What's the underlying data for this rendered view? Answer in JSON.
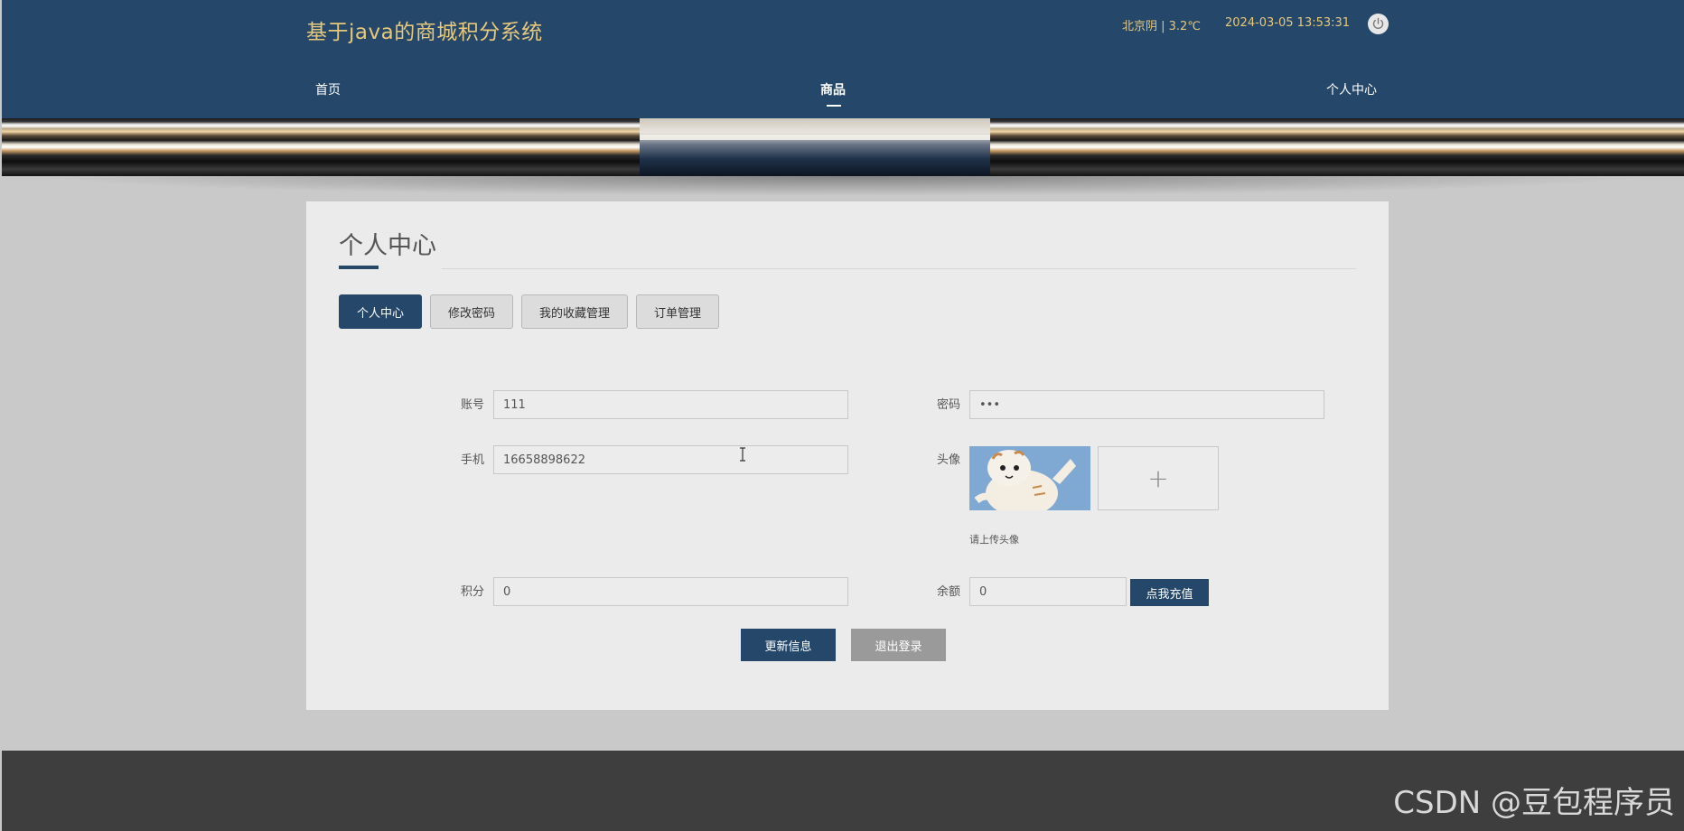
{
  "header": {
    "site_title": "基于java的商城积分系统",
    "weather": "北京阴 | 3.2℃",
    "datetime": "2024-03-05   13:53:31",
    "power_icon": "power-icon"
  },
  "nav": {
    "items": [
      {
        "label": "首页"
      },
      {
        "label": "商品"
      },
      {
        "label": "个人中心"
      }
    ],
    "active_index": 1
  },
  "page": {
    "title": "个人中心",
    "tabs": [
      {
        "label": "个人中心"
      },
      {
        "label": "修改密码"
      },
      {
        "label": "我的收藏管理"
      },
      {
        "label": "订单管理"
      }
    ],
    "active_tab": 0
  },
  "form": {
    "account": {
      "label": "账号",
      "value": "111"
    },
    "password": {
      "label": "密码",
      "value": "•••"
    },
    "phone": {
      "label": "手机",
      "value": "16658898622"
    },
    "avatar": {
      "label": "头像",
      "hint": "请上传头像",
      "upload_symbol": "+"
    },
    "points": {
      "label": "积分",
      "value": "0"
    },
    "balance": {
      "label": "余额",
      "value": "0",
      "recharge_label": "点我充值"
    }
  },
  "actions": {
    "update_label": "更新信息",
    "logout_label": "退出登录"
  },
  "footer": {
    "watermark": "CSDN @豆包程序员"
  },
  "colors": {
    "primary": "#24476a",
    "accent_text": "#e8c87a",
    "logout_button": "#9a9a9a"
  }
}
